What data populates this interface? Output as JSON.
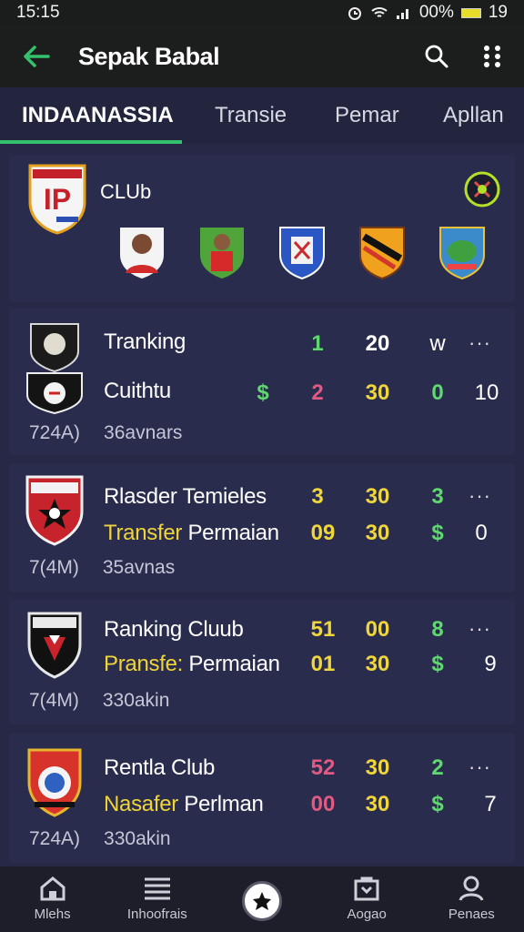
{
  "status": {
    "time": "15:15",
    "battery": "00%",
    "extra": "19"
  },
  "appbar": {
    "title": "Sepak Babal"
  },
  "tabs": [
    {
      "label": "INDAANASSIA",
      "active": true
    },
    {
      "label": "Transie"
    },
    {
      "label": "Pemar"
    },
    {
      "label": "Apllan"
    }
  ],
  "club": {
    "label": "CLUb"
  },
  "cards": [
    {
      "name": "Tranking",
      "sub": "Cuithtu",
      "sub_highlight": "",
      "meta_a": "724A)",
      "meta_b": "36avnars",
      "row1": [
        "1",
        "20",
        "w",
        "···"
      ],
      "row2": [
        "$",
        "2",
        "30",
        "0",
        "10"
      ]
    },
    {
      "name": "Rlasder Temieles",
      "sub_highlight": "Transfer",
      "sub": " Permaian",
      "meta_a": "7(4M)",
      "meta_b": "35avnas",
      "row1": [
        "3",
        "30",
        "3",
        "···"
      ],
      "row2": [
        "09",
        "30",
        "$",
        "0"
      ]
    },
    {
      "name": "Ranking Cluub",
      "sub_highlight": "Pransfe:",
      "sub": " Permaian",
      "meta_a": "7(4M)",
      "meta_b": "330akin",
      "row1": [
        "51",
        "00",
        "8",
        "···"
      ],
      "row2": [
        "01",
        "30",
        "$",
        "9"
      ]
    },
    {
      "name": "Rentla Club",
      "sub_highlight": "Nasafer",
      "sub": " Perlman",
      "meta_a": "724A)",
      "meta_b": "330akin",
      "row1": [
        "52",
        "30",
        "2",
        "···"
      ],
      "row2": [
        "00",
        "30",
        "$",
        "7"
      ]
    }
  ],
  "bottom_nav": [
    {
      "label": "Mlehs",
      "icon": "home-icon"
    },
    {
      "label": "Inhoofrais",
      "icon": "menu-icon"
    },
    {
      "label": "",
      "icon": "ball-icon"
    },
    {
      "label": "Aogao",
      "icon": "bag-icon"
    },
    {
      "label": "Penaes",
      "icon": "profile-icon"
    }
  ],
  "colors": {
    "accent_green": "#33c16d",
    "highlight_yellow": "#efd63a",
    "pink": "#e05a83",
    "card_bg": "#2a2c4d"
  }
}
